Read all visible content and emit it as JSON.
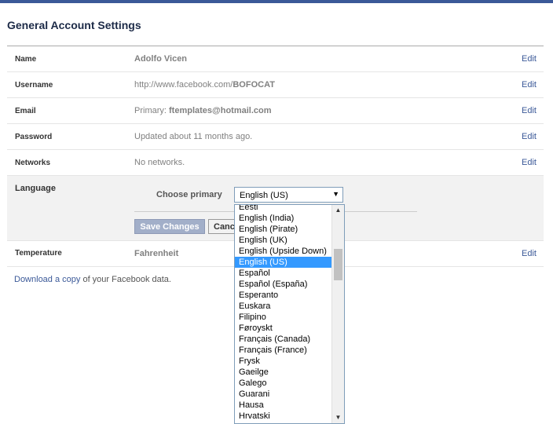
{
  "page": {
    "title": "General Account Settings"
  },
  "rows": [
    {
      "label": "Name",
      "value": "Adolfo Vicen",
      "edit": "Edit"
    },
    {
      "label": "Username",
      "value_prefix": "http://www.facebook.com/",
      "value_bold": "BOFOCAT",
      "edit": "Edit"
    },
    {
      "label": "Email",
      "value_prefix": "Primary: ",
      "value_bold": "ftemplates@hotmail.com",
      "edit": "Edit"
    },
    {
      "label": "Password",
      "value": "Updated about 11 months ago.",
      "edit": "Edit"
    },
    {
      "label": "Networks",
      "value": "No networks.",
      "edit": "Edit"
    }
  ],
  "language": {
    "label": "Language",
    "choose_label": "Choose primary",
    "selected": "English (US)",
    "save_label": "Save Changes",
    "cancel_label": "Cancel",
    "options": [
      "Eesti",
      "English (India)",
      "English (Pirate)",
      "English (UK)",
      "English (Upside Down)",
      "English (US)",
      "Español",
      "Español (España)",
      "Esperanto",
      "Euskara",
      "Filipino",
      "Føroyskt",
      "Français (Canada)",
      "Français (France)",
      "Frysk",
      "Gaeilge",
      "Galego",
      "Guarani",
      "Hausa",
      "Hrvatski"
    ],
    "selected_index": 5
  },
  "temperature": {
    "label": "Temperature",
    "value": "Fahrenheit",
    "edit": "Edit"
  },
  "footer": {
    "link": "Download a copy",
    "suffix": " of your Facebook data."
  },
  "colors": {
    "brand": "#3b5998",
    "selection": "#3399ff"
  }
}
